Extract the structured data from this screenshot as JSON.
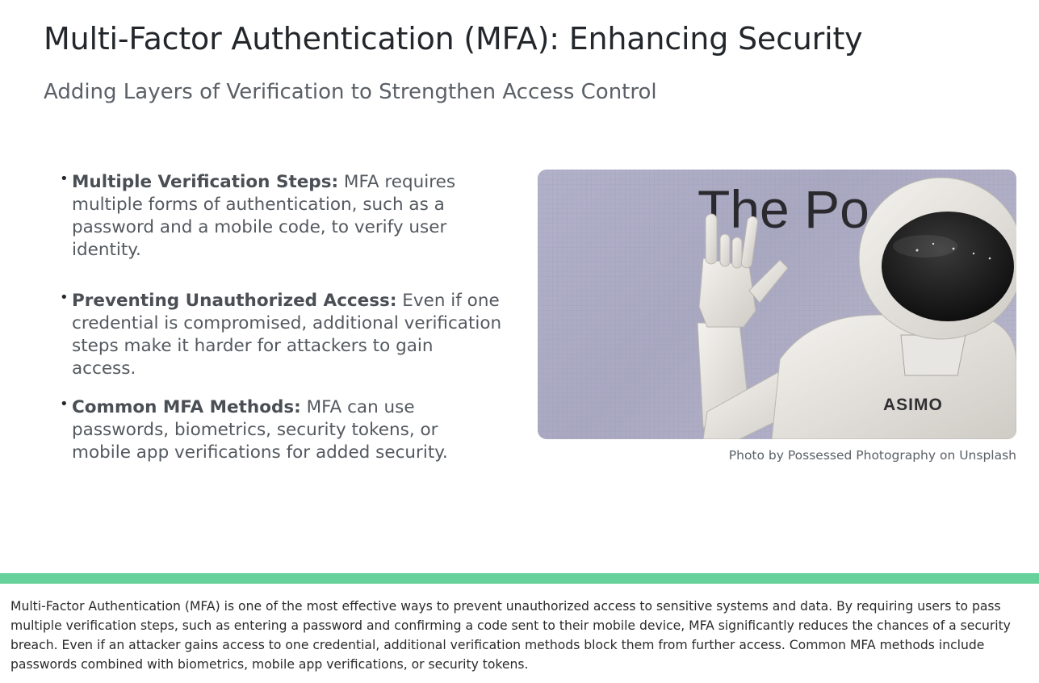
{
  "slide": {
    "title": "Multi-Factor Authentication (MFA): Enhancing Security",
    "subtitle": "Adding Layers of Verification to Strengthen Access Control",
    "bullets": [
      {
        "lead": "Multiple Verification Steps:",
        "text": " MFA requires multiple forms of authentication, such as a password and a mobile code, to verify user identity."
      },
      {
        "lead": "Preventing Unauthorized Access:",
        "text": " Even if one credential is compromised, additional verification steps make it harder for attackers to gain access."
      },
      {
        "lead": "Common MFA Methods:",
        "text": " MFA can use passwords, biometrics, security tokens, or mobile app verifications for added security."
      }
    ],
    "photo": {
      "sign_text": "The Po",
      "robot_label": "ASIMO"
    },
    "photo_caption": "Photo by Possessed Photography on Unsplash"
  },
  "notes": {
    "text": "Multi-Factor Authentication (MFA) is one of the most effective ways to prevent unauthorized access to sensitive systems and data. By requiring users to pass multiple verification steps, such as entering a password and confirming a code sent to their mobile device, MFA significantly reduces the chances of a security breach. Even if an attacker gains access to one credential, additional verification methods block them from further access. Common MFA methods include passwords combined with biometrics, mobile app verifications, or security tokens."
  },
  "colors": {
    "accent_bar": "#66d19b",
    "title": "#23272b",
    "body": "#54595f"
  }
}
